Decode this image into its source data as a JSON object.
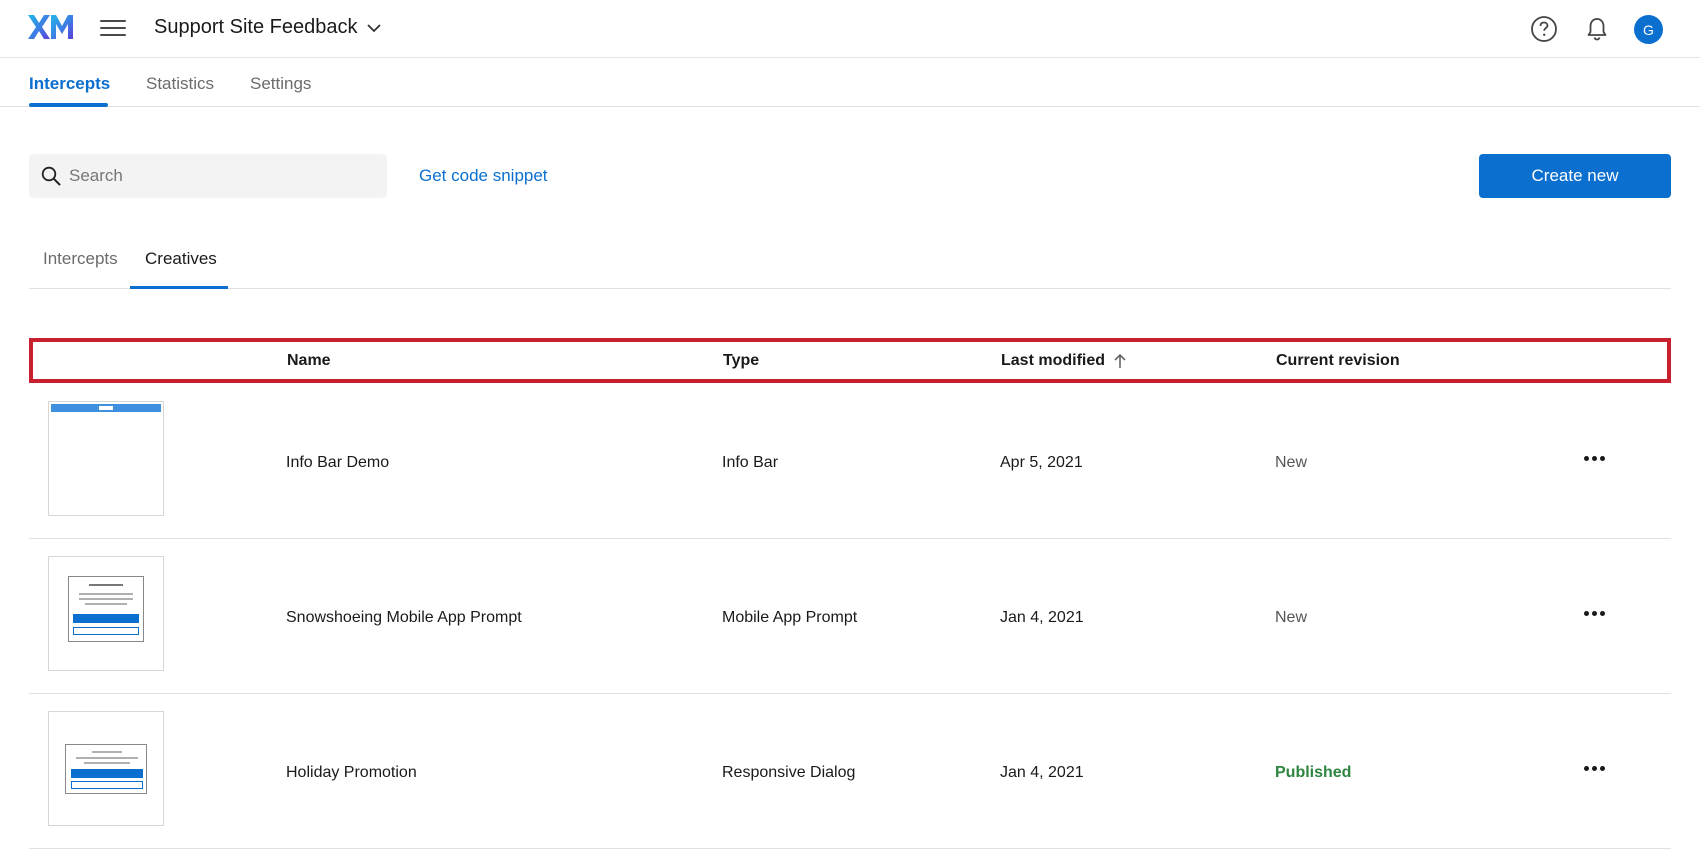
{
  "header": {
    "logo_text": "XM",
    "project_name": "Support Site Feedback",
    "avatar_initial": "G"
  },
  "primary_tabs": [
    {
      "label": "Intercepts",
      "active": true
    },
    {
      "label": "Statistics",
      "active": false
    },
    {
      "label": "Settings",
      "active": false
    }
  ],
  "toolbar": {
    "search_placeholder": "Search",
    "code_snippet_label": "Get code snippet",
    "create_label": "Create new"
  },
  "secondary_tabs": [
    {
      "label": "Intercepts",
      "active": false
    },
    {
      "label": "Creatives",
      "active": true
    }
  ],
  "table": {
    "columns": [
      "Name",
      "Type",
      "Last modified",
      "Current revision"
    ],
    "sort": {
      "column": "Last modified",
      "direction": "ascending"
    },
    "rows": [
      {
        "name": "Info Bar Demo",
        "type": "Info Bar",
        "modified": "Apr 5, 2021",
        "revision": "New"
      },
      {
        "name": "Snowshoeing Mobile App Prompt",
        "type": "Mobile App Prompt",
        "modified": "Jan 4, 2021",
        "revision": "New"
      },
      {
        "name": "Holiday Promotion",
        "type": "Responsive Dialog",
        "modified": "Jan 4, 2021",
        "revision": "Published"
      }
    ]
  },
  "colors": {
    "accent": "#0b6fd0",
    "highlight_border": "#c8202f",
    "published": "#2e8540"
  },
  "icons": {
    "menu": "hamburger-icon",
    "project_dropdown": "chevron-down-icon",
    "help": "help-icon",
    "notifications": "bell-icon",
    "search": "search-icon",
    "sort": "arrow-up-icon",
    "row_actions": "more-horizontal-icon"
  }
}
